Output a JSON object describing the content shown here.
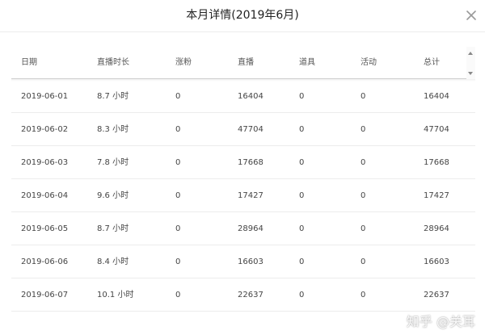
{
  "dialog": {
    "title": "本月详情(2019年6月)",
    "close_icon": "close-icon"
  },
  "table": {
    "headers": [
      "日期",
      "直播时长",
      "涨粉",
      "直播",
      "道具",
      "活动",
      "总计"
    ],
    "rows": [
      [
        "2019-06-01",
        "8.7 小时",
        "0",
        "16404",
        "0",
        "0",
        "16404"
      ],
      [
        "2019-06-02",
        "8.3 小时",
        "0",
        "47704",
        "0",
        "0",
        "47704"
      ],
      [
        "2019-06-03",
        "7.8 小时",
        "0",
        "17668",
        "0",
        "0",
        "17668"
      ],
      [
        "2019-06-04",
        "9.6 小时",
        "0",
        "17427",
        "0",
        "0",
        "17427"
      ],
      [
        "2019-06-05",
        "8.7 小时",
        "0",
        "28964",
        "0",
        "0",
        "28964"
      ],
      [
        "2019-06-06",
        "8.4 小时",
        "0",
        "16603",
        "0",
        "0",
        "16603"
      ],
      [
        "2019-06-07",
        "10.1 小时",
        "0",
        "22637",
        "0",
        "0",
        "22637"
      ]
    ]
  },
  "watermark": {
    "text": "知乎 @关耳"
  },
  "icons": {
    "scroll_up": "scroll-up-icon",
    "scroll_down": "scroll-down-icon"
  },
  "colors": {
    "background": "#ffffff",
    "text": "#444444",
    "header_text": "#555555",
    "divider": "#ececec"
  }
}
